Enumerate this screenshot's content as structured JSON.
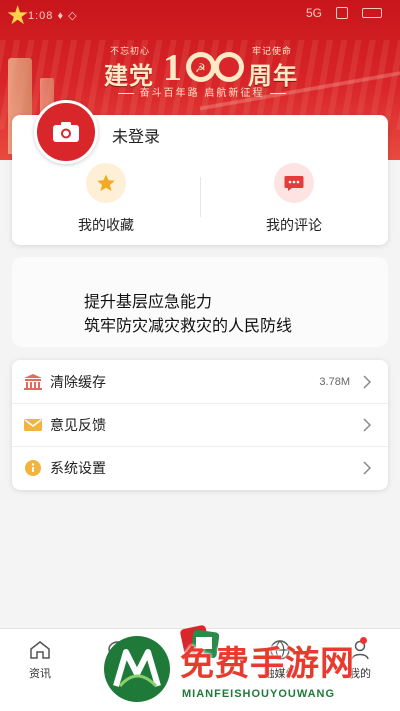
{
  "status_bar": {
    "left_text": "1:08  ♦  ◇",
    "right_text": "5G"
  },
  "banner": {
    "small_left": "不忘初心",
    "small_right": "牢记使命",
    "title_left": "建党",
    "title_num": "100",
    "title_right": "周年",
    "subtitle": "奋斗百年路 启航新征程"
  },
  "profile": {
    "login_status": "未登录",
    "favorites_label": "我的收藏",
    "comments_label": "我的评论"
  },
  "slogan": {
    "line1": "提升基层应急能力",
    "line2": "筑牢防灾减灾救灾的人民防线"
  },
  "settings": {
    "items": [
      {
        "label": "清除缓存",
        "value": "3.78M",
        "icon": "building-icon"
      },
      {
        "label": "意见反馈",
        "value": "",
        "icon": "mail-icon"
      },
      {
        "label": "系统设置",
        "value": "",
        "icon": "info-icon"
      }
    ]
  },
  "tabs": [
    {
      "label": "资讯",
      "icon": "home-icon"
    },
    {
      "label": "发",
      "icon": "chat-icon"
    },
    {
      "label": "",
      "icon": "center-logo-icon"
    },
    {
      "label": "融媒体",
      "icon": "globe-icon"
    },
    {
      "label": "我的",
      "icon": "user-icon"
    }
  ],
  "watermark": {
    "title": "免费手游网",
    "subtitle": "MIANFEISHOUYOUWANG"
  },
  "colors": {
    "brand_red": "#d9262a",
    "gold": "#ffe9c6",
    "star": "#f3a923",
    "comment": "#e53b3b"
  }
}
